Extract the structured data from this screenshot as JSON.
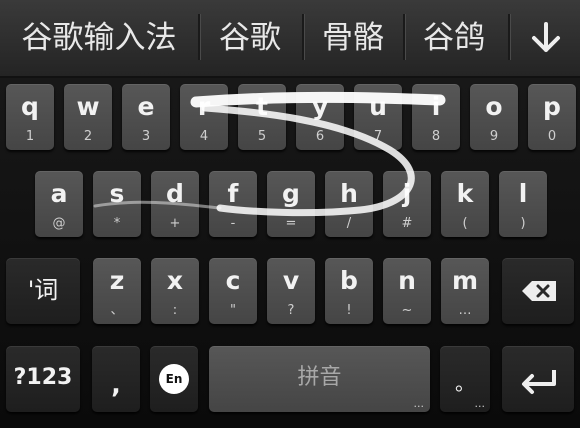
{
  "candidates": [
    "谷歌输入法",
    "谷歌",
    "骨骼",
    "谷鸽"
  ],
  "collapse_icon": "arrow-down-icon",
  "rows": {
    "row1": [
      [
        "q",
        "1"
      ],
      [
        "w",
        "2"
      ],
      [
        "e",
        "3"
      ],
      [
        "r",
        "4"
      ],
      [
        "t",
        "5"
      ],
      [
        "y",
        "6"
      ],
      [
        "u",
        "7"
      ],
      [
        "i",
        "8"
      ],
      [
        "o",
        "9"
      ],
      [
        "p",
        "0"
      ]
    ],
    "row2": [
      [
        "a",
        "@"
      ],
      [
        "s",
        "*"
      ],
      [
        "d",
        "+"
      ],
      [
        "f",
        "-"
      ],
      [
        "g",
        "="
      ],
      [
        "h",
        "/"
      ],
      [
        "j",
        "#"
      ],
      [
        "k",
        "("
      ],
      [
        "l",
        ")"
      ]
    ],
    "row3": [
      [
        "z",
        "、"
      ],
      [
        "x",
        ":"
      ],
      [
        "c",
        "\""
      ],
      [
        "v",
        "?"
      ],
      [
        "b",
        "!"
      ],
      [
        "n",
        "~"
      ],
      [
        "m",
        "…"
      ]
    ]
  },
  "keys": {
    "lang_switch": "'词",
    "symbols": "?123",
    "comma": ",",
    "en_badge": "En",
    "space": "拼音",
    "space_hint": "...",
    "period": "。",
    "period_hint": "...",
    "backspace_icon": "backspace-icon",
    "enter_icon": "enter-arrow-icon"
  },
  "colors": {
    "key": "#4f4f4f",
    "function_key": "#242424",
    "trail": "#ffffff"
  }
}
